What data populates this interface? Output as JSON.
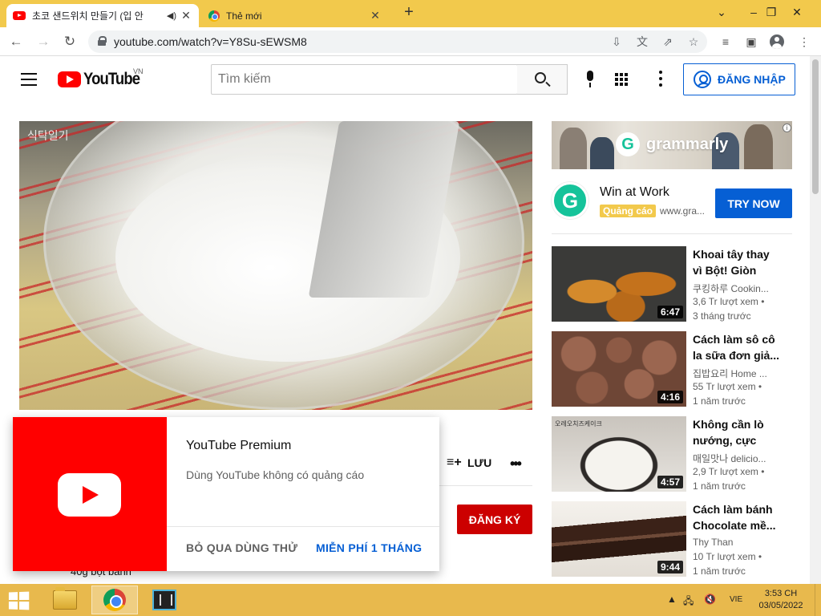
{
  "browser": {
    "tabs": [
      {
        "title": "초코 샌드위치 만들기 (입 안",
        "favicon": "youtube-icon",
        "active": true
      },
      {
        "title": "Thẻ mới",
        "favicon": "chrome-icon",
        "active": false
      }
    ],
    "new_tab_symbol": "+",
    "url": "youtube.com/watch?v=Y8Su-sEWSM8"
  },
  "youtube": {
    "logo_text": "YouTube",
    "country_code": "VN",
    "search_placeholder": "Tìm kiếm",
    "signin_label": "ĐĂNG NHẬP",
    "video_watermark": "식탁일기",
    "save_label": "LƯU",
    "more_label": "•••",
    "subscribe_label": "ĐĂNG KÝ",
    "description_peek": "40g bột bánh"
  },
  "ad": {
    "brand": "grammarly",
    "title": "Win at Work",
    "badge": "Quảng cáo",
    "url": "www.gra...",
    "cta": "TRY NOW",
    "info_symbol": "i",
    "icon_letter": "G",
    "brand_color": "#15c39a"
  },
  "recommendations": [
    {
      "title": "Khoai tây thay vì Bột! Giòn và...",
      "channel": "쿠킹하루 Cookin...",
      "views": "3,6 Tr lượt xem •",
      "age": "3 tháng trước",
      "duration": "6:47"
    },
    {
      "title": "Cách làm sô cô la sữa đơn giả...",
      "channel": "집밥요리 Home ...",
      "views": "55 Tr lượt xem •",
      "age": "1 năm trước",
      "duration": "4:16"
    },
    {
      "title": "Không cần lò nướng, cực kỳ...",
      "channel": "매일맛나 delicio...",
      "views": "2,9 Tr lượt xem •",
      "age": "1 năm trước",
      "duration": "4:57",
      "thumb_label": "오레오치즈케이크"
    },
    {
      "title": "Cách làm bánh Chocolate mề...",
      "channel": "Thy Than",
      "views": "10 Tr lượt xem •",
      "age": "1 năm trước",
      "duration": "9:44"
    }
  ],
  "premium_popup": {
    "title": "YouTube Premium",
    "subtitle": "Dùng YouTube không có quảng cáo",
    "skip_label": "BỎ QUA DÙNG THỬ",
    "free_label": "MIỄN PHÍ 1 THÁNG"
  },
  "taskbar": {
    "language": "VIE",
    "time": "3:53 CH",
    "date": "03/05/2022"
  },
  "colors": {
    "chrome_frame": "#f2c94c",
    "taskbar": "#e8b94d",
    "youtube_red": "#ff0000",
    "link_blue": "#065fd4",
    "subscribe_red": "#cc0000"
  }
}
